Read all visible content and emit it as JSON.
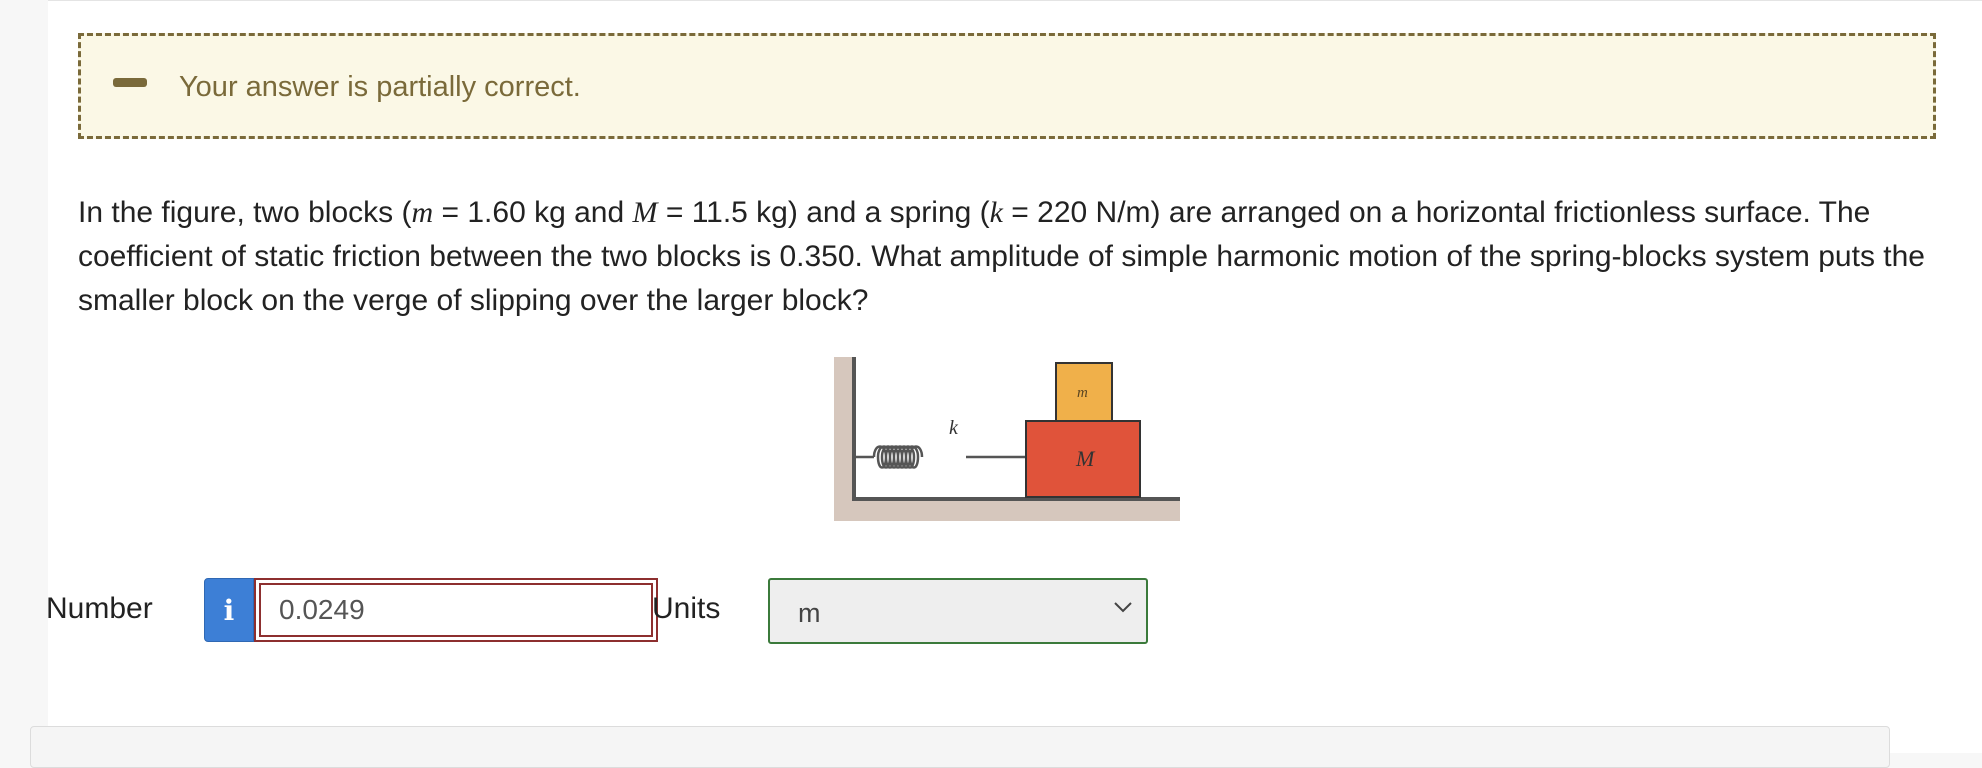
{
  "feedback": {
    "message": "Your answer is partially correct.",
    "icon": "minus-icon",
    "border_color": "#7a6a3a",
    "background": "#fbf8e6"
  },
  "question": {
    "p1": "In the figure, two blocks (",
    "m_sym": "m",
    "p2": " = 1.60 kg and ",
    "M_sym": "M",
    "p3": " = 11.5 kg) and a spring (",
    "k_sym": "k",
    "p4": " = 220 N/m) are arranged on a horizontal frictionless surface. The coefficient of static friction between the two blocks is 0.350. What amplitude of simple harmonic motion of the spring-blocks system puts the smaller block on the verge of slipping over the larger block?"
  },
  "figure": {
    "spring_label": "k",
    "small_block_label": "m",
    "large_block_label": "M",
    "small_block_color": "#f0b04a",
    "large_block_color": "#e0533a",
    "wall_color": "#d6c7bd"
  },
  "answer": {
    "number_label": "Number",
    "info_icon": "info-icon",
    "value": "0.0249",
    "units_label": "Units",
    "units_value": "m"
  }
}
